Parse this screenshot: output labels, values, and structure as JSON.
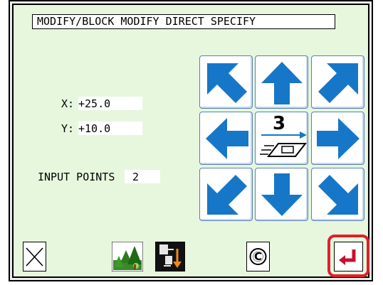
{
  "screen": {
    "title": "MODIFY/BLOCK MODIFY  DIRECT SPECIFY"
  },
  "coords": {
    "x_label": "X:",
    "x_value": "+25.0",
    "y_label": "Y:",
    "y_value": "+10.0"
  },
  "input_points": {
    "label": "INPUT POINTS",
    "value": "2"
  },
  "move_pad": {
    "speed": "3",
    "buttons": [
      "up-left",
      "up",
      "up-right",
      "left",
      "speed",
      "right",
      "down-left",
      "down",
      "down-right"
    ]
  },
  "toolbar": {
    "close_icon": "x-icon",
    "tree_icon": "forest-view-icon",
    "needle_icon": "needle-down-icon",
    "clear_icon": "c-clear-icon",
    "enter_icon": "enter-return-icon"
  },
  "colors": {
    "panel_bg": "#e6f7de",
    "arrow_blue": "#1677c8",
    "enter_red": "#c8102e",
    "highlight": "#e0202a"
  }
}
